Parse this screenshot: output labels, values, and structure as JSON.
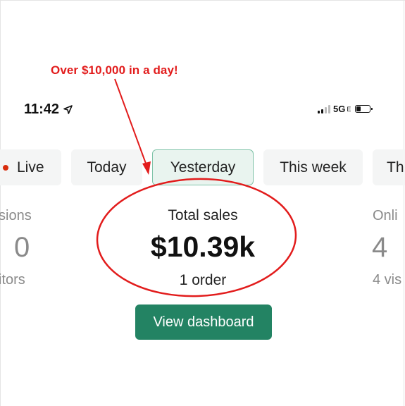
{
  "annotation": {
    "text": "Over $10,000 in a day!",
    "color": "#e21c1c"
  },
  "status_bar": {
    "time": "11:42",
    "location_icon": "location-arrow-icon",
    "network": "5G",
    "network_suffix": "E",
    "battery_icon": "battery-low-icon"
  },
  "tabs": [
    {
      "label": "Live",
      "indicator_color": "#d82c0d"
    },
    {
      "label": "Today"
    },
    {
      "label": "Yesterday",
      "selected": true
    },
    {
      "label": "This week"
    },
    {
      "label": "Th"
    }
  ],
  "left_metric": {
    "label": "sions",
    "value": "0",
    "sublabel": "itors"
  },
  "center_metric": {
    "label": "Total sales",
    "value": "$10.39k",
    "sublabel": "1 order"
  },
  "right_metric": {
    "label": "Onli",
    "value": "4",
    "sublabel": "4 vis"
  },
  "button": {
    "label": "View dashboard",
    "color": "#238363"
  }
}
